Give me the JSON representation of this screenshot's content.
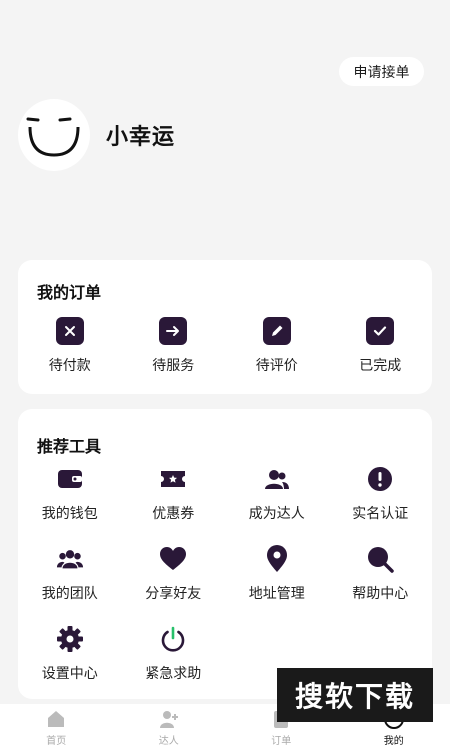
{
  "header": {
    "apply_label": "申请接单"
  },
  "profile": {
    "username": "小幸运"
  },
  "orders": {
    "title": "我的订单",
    "items": [
      {
        "label": "待付款",
        "icon": "x-icon"
      },
      {
        "label": "待服务",
        "icon": "arrow-right-icon"
      },
      {
        "label": "待评价",
        "icon": "pencil-icon"
      },
      {
        "label": "已完成",
        "icon": "check-icon"
      }
    ]
  },
  "tools": {
    "title": "推荐工具",
    "items": [
      {
        "label": "我的钱包",
        "icon": "wallet-icon"
      },
      {
        "label": "优惠券",
        "icon": "coupon-icon"
      },
      {
        "label": "成为达人",
        "icon": "users-icon"
      },
      {
        "label": "实名认证",
        "icon": "exclamation-icon"
      },
      {
        "label": "我的团队",
        "icon": "team-icon"
      },
      {
        "label": "分享好友",
        "icon": "heart-icon"
      },
      {
        "label": "地址管理",
        "icon": "location-pin-icon"
      },
      {
        "label": "帮助中心",
        "icon": "search-icon"
      },
      {
        "label": "设置中心",
        "icon": "gear-icon"
      },
      {
        "label": "紧急求助",
        "icon": "power-icon"
      }
    ]
  },
  "tabbar": {
    "items": [
      {
        "label": "首页",
        "icon": "home-icon"
      },
      {
        "label": "达人",
        "icon": "user-add-icon"
      },
      {
        "label": "订单",
        "icon": "order-icon"
      },
      {
        "label": "我的",
        "icon": "profile-icon"
      }
    ],
    "active_index": 3
  },
  "watermark": {
    "text": "搜软下载"
  },
  "colors": {
    "icon": "#2a1838",
    "background": "#f4f4f4",
    "card": "#ffffff",
    "power_accent": "#27c06b"
  }
}
